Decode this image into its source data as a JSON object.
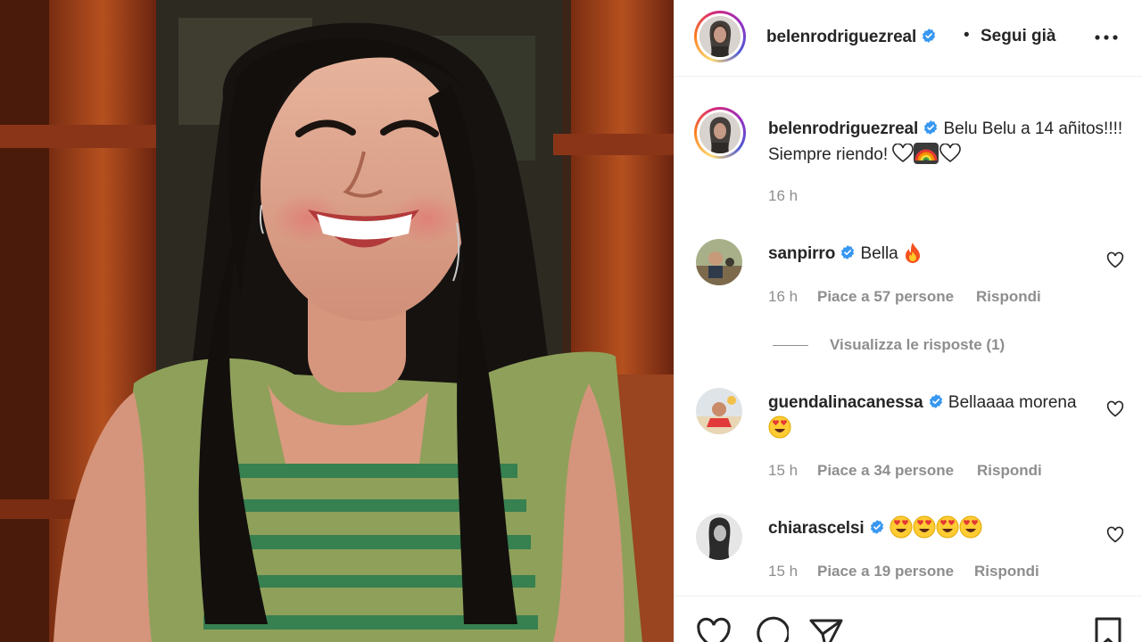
{
  "post": {
    "photo_alt": "Foto",
    "author": "belenrodriguezreal",
    "follow_separator": "•",
    "follow_label": "Segui già",
    "more_icon": "more-options-icon"
  },
  "caption": {
    "username": "belenrodriguezreal",
    "text": "Belu Belu a 14 añitos!!!! Siempre riendo!",
    "time": "16 h"
  },
  "comments": [
    {
      "username": "sanpirro",
      "text": "Bella",
      "emojis": [
        "fire"
      ],
      "time": "16 h",
      "likes": "Piace a 57 persone",
      "reply": "Rispondi",
      "view_replies": "Visualizza le risposte (1)"
    },
    {
      "username": "guendalinacanessa",
      "text": "Bellaaaa morena",
      "emojis": [
        "heart-eyes"
      ],
      "time": "15 h",
      "likes": "Piace a 34 persone",
      "reply": "Rispondi"
    },
    {
      "username": "chiarascelsi",
      "text": "",
      "emojis": [
        "heart-eyes",
        "heart-eyes",
        "heart-eyes",
        "heart-eyes"
      ],
      "time": "15 h",
      "likes": "Piace a 19 persone",
      "reply": "Rispondi"
    }
  ],
  "colors": {
    "verified": "#3897f0",
    "text": "#262626",
    "muted": "#8e8e8e"
  }
}
